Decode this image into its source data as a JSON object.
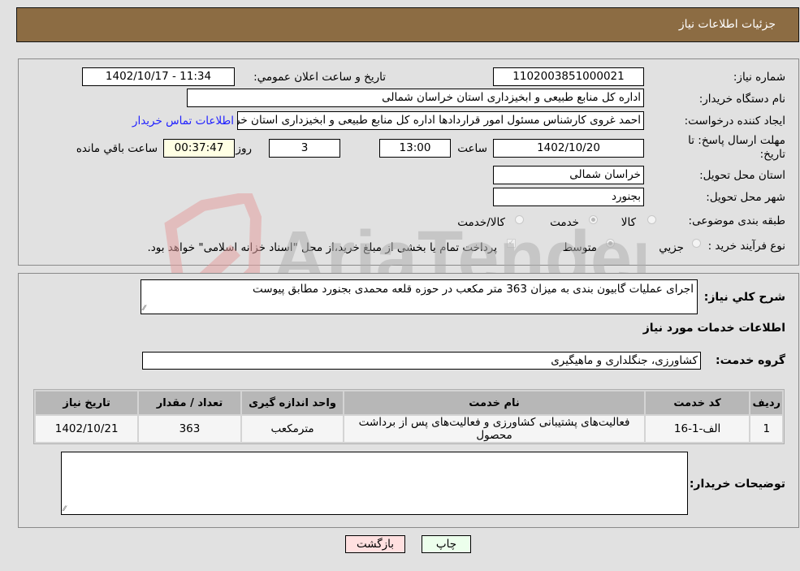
{
  "header": {
    "title": "جزئیات اطلاعات نیاز"
  },
  "details": {
    "need_number_label": "شماره نیاز:",
    "need_number": "1102003851000021",
    "announce_label": "تاریخ و ساعت اعلان عمومي:",
    "announce_value": "1402/10/17 - 11:34",
    "buyer_org_label": "نام دستگاه خریدار:",
    "buyer_org": "اداره کل منابع طبیعی و ابخیزداری استان خراسان شمالی",
    "creator_label": "ایجاد کننده درخواست:",
    "creator": "احمد غروی کارشناس مسئول امور قراردادها اداره کل منابع طبیعی و ابخیزداری استان خراسان شمالی",
    "contact_link": "اطلاعات تماس خریدار",
    "deadline_label": "مهلت ارسال پاسخ: تا تاریخ:",
    "deadline_date": "1402/10/20",
    "hour_label": "ساعت",
    "deadline_time": "13:00",
    "days_value": "3",
    "days_label": "روز و",
    "remaining_time": "00:37:47",
    "remaining_label": "ساعت باقي مانده",
    "province_label": "استان محل تحویل:",
    "province": "خراسان شمالی",
    "city_label": "شهر محل تحویل:",
    "city": "بجنورد",
    "category_label": "طبقه بندی موضوعی:",
    "category_options": [
      {
        "label": "کالا",
        "checked": false
      },
      {
        "label": "خدمت",
        "checked": true
      },
      {
        "label": "کالا/خدمت",
        "checked": false
      }
    ],
    "process_label": "نوع فرآیند خرید :",
    "process_options": [
      {
        "label": "جزيي",
        "checked": false
      },
      {
        "label": "متوسط",
        "checked": true
      }
    ],
    "payment_note": "پرداخت تمام یا بخشی از مبلغ خرید،از محل \"اسناد خزانه اسلامی\" خواهد بود.",
    "payment_checked": true
  },
  "description": {
    "label": "شرح کلي نياز:",
    "value": "اجرای عملیات گابیون بندی به میزان 363 متر مکعب در حوزه قلعه محمدی بجنورد مطابق پیوست"
  },
  "services": {
    "section_title": "اطلاعات خدمات مورد نیاز",
    "group_label": "گروه خدمت:",
    "group_value": "کشاورزی، جنگلداری و ماهیگیری",
    "columns": [
      "ردیف",
      "کد خدمت",
      "نام خدمت",
      "واحد اندازه گیری",
      "تعداد / مقدار",
      "تاریخ نیاز"
    ],
    "rows": [
      [
        "1",
        "الف-1-16",
        "فعالیت‌های پشتیبانی کشاورزی و فعالیت‌های پس از برداشت محصول",
        "مترمکعب",
        "363",
        "1402/10/21"
      ]
    ]
  },
  "buyer_notes": {
    "label": "توضیحات خریدار:",
    "value": ""
  },
  "buttons": {
    "print": "چاپ",
    "back": "بازگشت"
  },
  "watermark": {
    "text": "AriaTender.neT"
  },
  "colors": {
    "header_bg": "#8c6c43",
    "print_bg": "#ecffec",
    "back_bg": "#ffe0e0",
    "link": "#2020ff"
  }
}
